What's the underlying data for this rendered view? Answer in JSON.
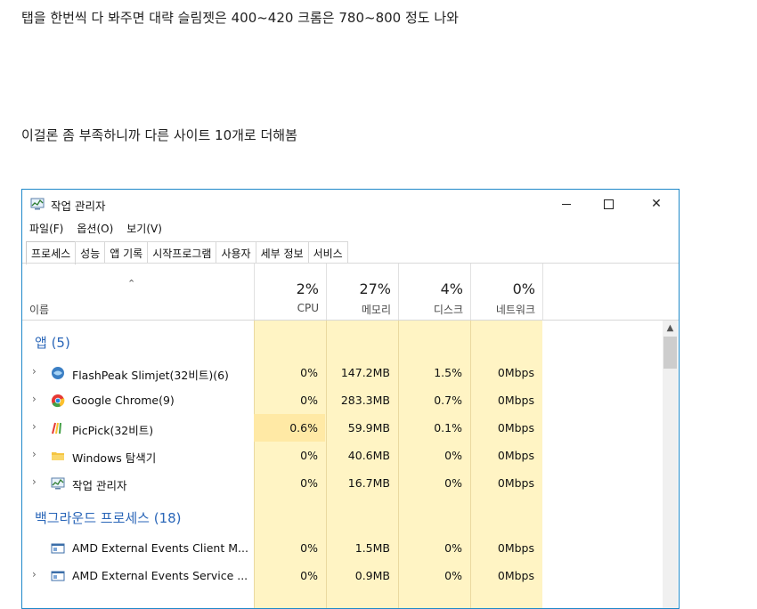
{
  "post": {
    "line1": "탭을 한번씩 다 봐주면 대략 슬림젯은 400~420 크롬은 780~800 정도 나와",
    "line2": "이걸론 좀 부족하니까 다른 사이트 10개로 더해봄"
  },
  "window": {
    "title": "작업 관리자",
    "menu": [
      "파일(F)",
      "옵션(O)",
      "보기(V)"
    ],
    "tabs": [
      "프로세스",
      "성능",
      "앱 기록",
      "시작프로그램",
      "사용자",
      "세부 정보",
      "서비스"
    ],
    "active_tab": "프로세스"
  },
  "columns": {
    "name_label": "이름",
    "cpu": {
      "pct": "2%",
      "label": "CPU"
    },
    "mem": {
      "pct": "27%",
      "label": "메모리"
    },
    "disk": {
      "pct": "4%",
      "label": "디스크"
    },
    "net": {
      "pct": "0%",
      "label": "네트워크"
    }
  },
  "groups": {
    "apps": "앱 (5)",
    "background": "백그라운드 프로세스 (18)"
  },
  "apps": [
    {
      "name": "FlashPeak Slimjet(32비트)(6)",
      "cpu": "0%",
      "mem": "147.2MB",
      "disk": "1.5%",
      "net": "0Mbps",
      "icon": "slimjet-icon"
    },
    {
      "name": "Google Chrome(9)",
      "cpu": "0%",
      "mem": "283.3MB",
      "disk": "0.7%",
      "net": "0Mbps",
      "icon": "chrome-icon"
    },
    {
      "name": "PicPick(32비트)",
      "cpu": "0.6%",
      "mem": "59.9MB",
      "disk": "0.1%",
      "net": "0Mbps",
      "icon": "picpick-icon"
    },
    {
      "name": "Windows 탐색기",
      "cpu": "0%",
      "mem": "40.6MB",
      "disk": "0%",
      "net": "0Mbps",
      "icon": "folder-icon"
    },
    {
      "name": "작업 관리자",
      "cpu": "0%",
      "mem": "16.7MB",
      "disk": "0%",
      "net": "0Mbps",
      "icon": "task-manager-icon"
    }
  ],
  "background": [
    {
      "name": "AMD External Events Client M...",
      "cpu": "0%",
      "mem": "1.5MB",
      "disk": "0%",
      "net": "0Mbps",
      "icon": "service-icon"
    },
    {
      "name": "AMD External Events Service ...",
      "cpu": "0%",
      "mem": "0.9MB",
      "disk": "0%",
      "net": "0Mbps",
      "icon": "service-icon"
    }
  ],
  "colors": {
    "accent": "#1e88c9",
    "group": "#2a66b8",
    "heat": "#fff4c4"
  }
}
